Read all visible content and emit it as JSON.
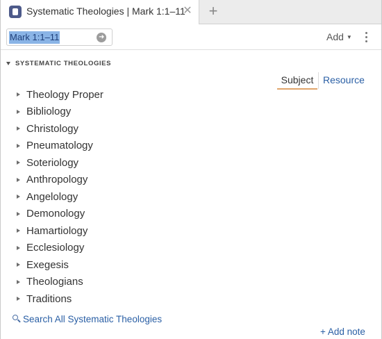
{
  "tab": {
    "title": "Systematic Theologies | Mark 1:1–11",
    "close_glyph": "✕",
    "new_tab_glyph": "+"
  },
  "toolbar": {
    "reference_value": "Mark 1:1–11",
    "go_glyph": "➜",
    "add_label": "Add",
    "add_caret": "▼"
  },
  "section": {
    "title": "SYSTEMATIC THEOLOGIES"
  },
  "view_toggle": {
    "subject_label": "Subject",
    "resource_label": "Resource",
    "selected": "Subject"
  },
  "tree": {
    "items": [
      {
        "label": "Theology Proper"
      },
      {
        "label": "Bibliology"
      },
      {
        "label": "Christology"
      },
      {
        "label": "Pneumatology"
      },
      {
        "label": "Soteriology"
      },
      {
        "label": "Anthropology"
      },
      {
        "label": "Angelology"
      },
      {
        "label": "Demonology"
      },
      {
        "label": "Hamartiology"
      },
      {
        "label": "Ecclesiology"
      },
      {
        "label": "Exegesis"
      },
      {
        "label": "Theologians"
      },
      {
        "label": "Traditions"
      }
    ]
  },
  "footer": {
    "search_all_label": "Search All Systematic Theologies",
    "add_note_label": "+ Add note"
  },
  "colors": {
    "link": "#2a5fa5",
    "accent_underline": "#e0a46a",
    "tab_icon": "#4d5a8a",
    "selection": "#8ab4e6"
  },
  "icons": {
    "tab_icon": "resource-book-icon",
    "go": "arrow-right-circle-icon",
    "more": "vertical-ellipsis-icon",
    "search": "magnifier-icon"
  }
}
